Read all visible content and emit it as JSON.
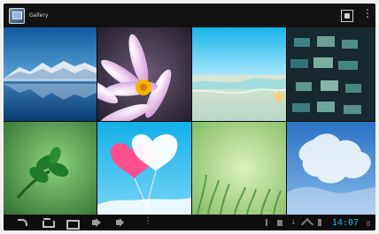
{
  "action_bar": {
    "title": "Gallery",
    "icons": [
      "gallery-app-icon",
      "camera-icon",
      "overflow-menu-icon"
    ]
  },
  "grid": {
    "thumbnails": [
      "mountain-lake-thumbnail",
      "pink-flower-thumbnail",
      "beach-starfish-thumbnail",
      "bokeh-lights-thumbnail",
      "green-plant-thumbnail",
      "heart-balloons-thumbnail",
      "grass-field-thumbnail",
      "blue-sky-clouds-thumbnail"
    ]
  },
  "nav_bar": {
    "buttons": [
      "back-icon",
      "home-icon",
      "recent-apps-icon",
      "volume-down-icon",
      "volume-up-icon",
      "menu-icon"
    ]
  },
  "status_bar": {
    "time": "14:07",
    "time_color": "#1fb7e6",
    "icons": [
      "usb-icon",
      "sd-card-icon",
      "download-icon",
      "wifi-icon",
      "battery-icon",
      "signal-icon"
    ]
  }
}
